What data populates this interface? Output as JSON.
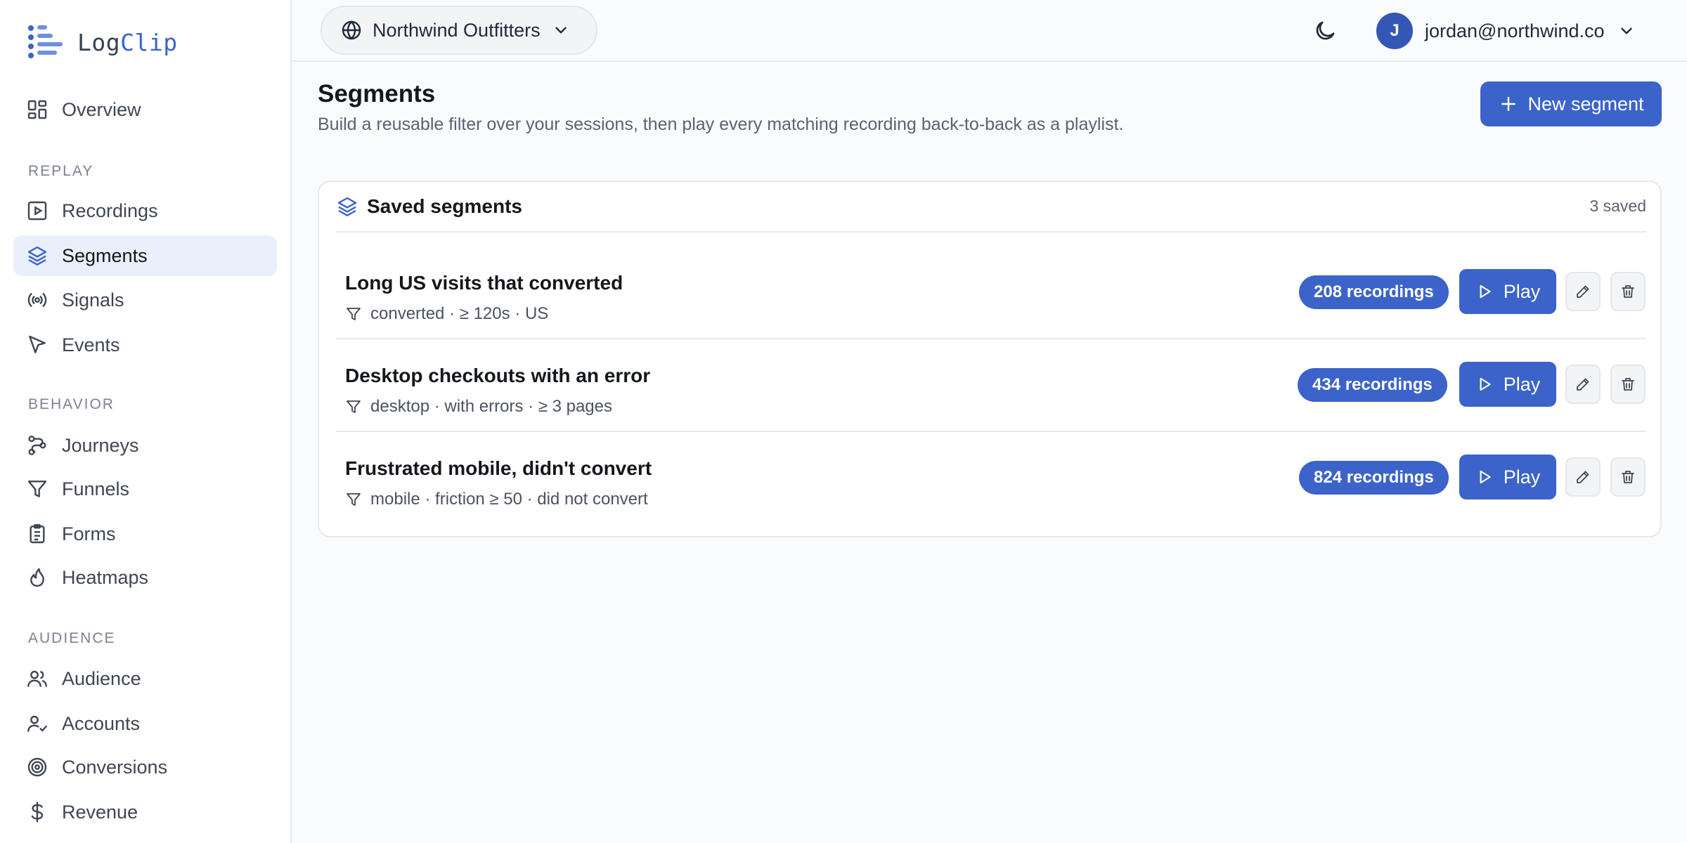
{
  "brand": {
    "part1": "Log",
    "part2": "Clip",
    "accent": "#3b63c9"
  },
  "sidebar": {
    "overview": "Overview",
    "sections": {
      "replay": "REPLAY",
      "behavior": "BEHAVIOR",
      "audience": "AUDIENCE"
    },
    "items": {
      "recordings": "Recordings",
      "segments": "Segments",
      "signals": "Signals",
      "events": "Events",
      "journeys": "Journeys",
      "funnels": "Funnels",
      "forms": "Forms",
      "heatmaps": "Heatmaps",
      "audience": "Audience",
      "accounts": "Accounts",
      "conversions": "Conversions",
      "revenue": "Revenue"
    },
    "active": "segments"
  },
  "topbar": {
    "org": "Northwind Outfitters",
    "user_initial": "J",
    "user_email": "jordan@northwind.co"
  },
  "page": {
    "title": "Segments",
    "description": "Build a reusable filter over your sessions, then play every matching recording back-to-back as a playlist.",
    "new_button": "New segment"
  },
  "card": {
    "title": "Saved segments",
    "count": "3 saved",
    "segments": [
      {
        "name": "Long US visits that converted",
        "filter": "converted · ≥ 120s · US",
        "recordings": "208 recordings",
        "play": "Play"
      },
      {
        "name": "Desktop checkouts with an error",
        "filter": "desktop · with errors · ≥ 3 pages",
        "recordings": "434 recordings",
        "play": "Play"
      },
      {
        "name": "Frustrated mobile, didn't convert",
        "filter": "mobile · friction ≥ 50 · did not convert",
        "recordings": "824 recordings",
        "play": "Play"
      }
    ]
  }
}
